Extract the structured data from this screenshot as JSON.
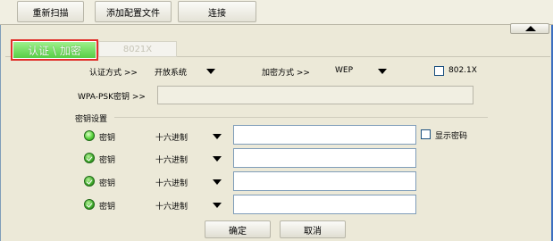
{
  "toolbar": {
    "rescan": "重新扫描",
    "add_profile": "添加配置文件",
    "connect": "连接"
  },
  "tabs": {
    "auth_encrypt": "认证 \\ 加密",
    "dot1x": "8021X"
  },
  "auth": {
    "auth_mode_label": "认证方式 >>",
    "auth_mode_value": "开放系统",
    "encrypt_label": "加密方式 >>",
    "encrypt_value": "WEP",
    "dot1x_label": "802.1X",
    "wpa_psk_label": "WPA-PSK密钥 >>"
  },
  "keys": {
    "group_label": "密钥设置",
    "show_password": "显示密码",
    "rows": [
      {
        "label": "密钥",
        "format": "十六进制",
        "selected": true
      },
      {
        "label": "密钥",
        "format": "十六进制",
        "selected": false
      },
      {
        "label": "密钥",
        "format": "十六进制",
        "selected": false
      },
      {
        "label": "密钥",
        "format": "十六进制",
        "selected": false
      }
    ]
  },
  "actions": {
    "ok": "确定",
    "cancel": "取消"
  },
  "colors": {
    "tab_active_green": "#57cf45",
    "tab_highlight_red": "#e0302a",
    "background": "#ece9d8"
  }
}
